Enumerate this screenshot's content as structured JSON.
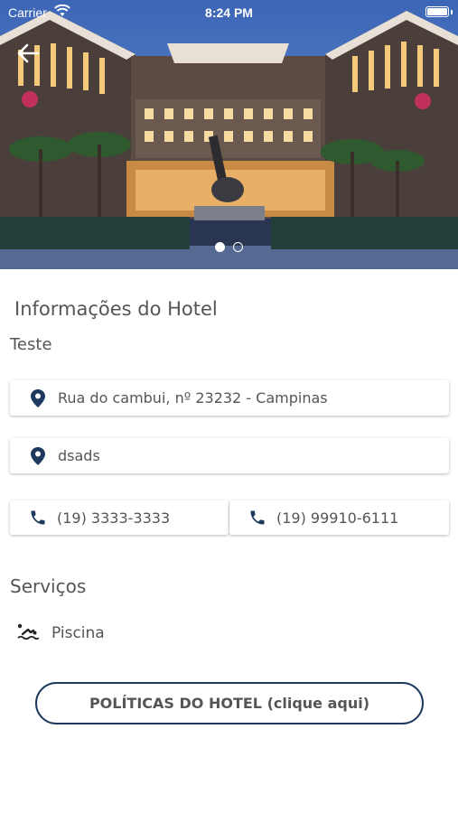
{
  "status_bar": {
    "carrier": "Carrier",
    "time": "8:24 PM"
  },
  "hero": {
    "carousel_total": 2,
    "carousel_active": 1
  },
  "hotel_info": {
    "title": "Informações do Hotel",
    "name": "Teste"
  },
  "addresses": [
    {
      "text": "Rua do cambui, nº 23232 - Campinas",
      "icon": "location-pin-icon"
    },
    {
      "text": "dsads",
      "icon": "location-pin-icon"
    }
  ],
  "phones": [
    {
      "number": "(19) 3333-3333",
      "icon": "phone-icon"
    },
    {
      "number": "(19) 99910-6111",
      "icon": "phone-icon"
    }
  ],
  "services": {
    "title": "Serviços",
    "items": [
      {
        "label": "Piscina",
        "icon": "swimming-icon"
      }
    ]
  },
  "policy_button": {
    "label": "POLÍTICAS DO HOTEL (clique aqui)"
  },
  "colors": {
    "accent": "#1d3a5e",
    "text": "#555555",
    "icon": "#1d3a5e"
  }
}
